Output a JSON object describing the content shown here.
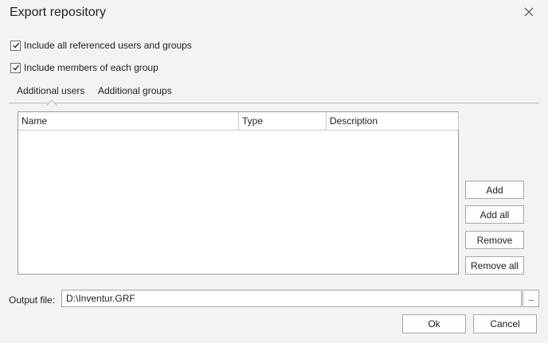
{
  "dialog": {
    "title": "Export repository",
    "close_icon": "close-icon"
  },
  "options": {
    "include_referenced": {
      "label": "Include all referenced users and groups",
      "checked": true
    },
    "include_members": {
      "label": "Include members of each group",
      "checked": true
    }
  },
  "tabs": [
    {
      "label": "Additional users",
      "active": true
    },
    {
      "label": "Additional groups",
      "active": false
    }
  ],
  "grid": {
    "columns": [
      "Name",
      "Type",
      "Description"
    ],
    "rows": []
  },
  "side_buttons": {
    "add": "Add",
    "add_all": "Add all",
    "remove": "Remove",
    "remove_all": "Remove all"
  },
  "output": {
    "label": "Output file:",
    "value": "D:\\Inventur.GRF",
    "browse": "..."
  },
  "footer": {
    "ok": "Ok",
    "cancel": "Cancel"
  }
}
